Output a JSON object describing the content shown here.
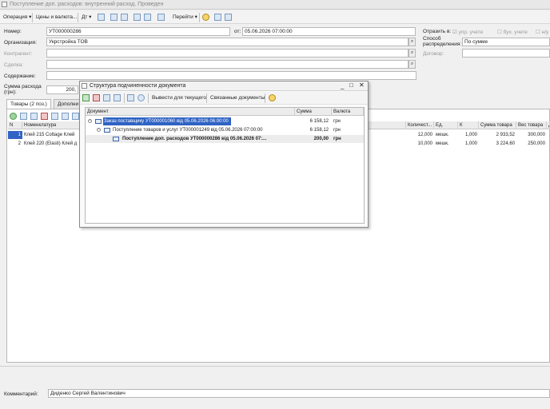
{
  "window": {
    "title": "Поступление доп. расходов: внутренний расход. Проведен"
  },
  "toolbar": {
    "operation": "Операция",
    "prices": "Цены и валюта...",
    "goto": "Перейти"
  },
  "header": {
    "number_label": "Номер:",
    "number_value": "УТ000000286",
    "from_label": "от:",
    "date_value": "05.06.2026 07:00:00",
    "reflect_label": "Отразить в:",
    "mgmt_label": "упр. учете",
    "acct_label": "бух. учете",
    "tax_label": "н/у",
    "org_label": "Организация:",
    "org_value": "Укрстройка ТОВ",
    "method_label": "Способ распределения:",
    "method_value": "По сумме",
    "contractor_label": "Контрагент:",
    "contract_label": "Договор:",
    "deal_label": "Сделка:",
    "content_label": "Содержание:",
    "sum_label": "Сумма расхода (грн):",
    "sum_value": "200,"
  },
  "tabs": [
    {
      "label": "Товары (2 поз.)"
    },
    {
      "label": "Дополни"
    }
  ],
  "goods": {
    "columns": [
      "N",
      "Номенклатура",
      "Количест...",
      "Ед.",
      "К",
      "Сумма товара",
      "Вес товара",
      "Д"
    ],
    "rows": [
      {
        "n": "1",
        "item": "Клей 215 Cottage Клей",
        "qty": "12,000",
        "unit": "мешк.",
        "k": "1,000",
        "sum": "2 933,52",
        "weight": "300,000"
      },
      {
        "n": "2",
        "item": "Клей 220 (Elasti) Клей д",
        "qty": "10,000",
        "unit": "мешк.",
        "k": "1,000",
        "sum": "3 224,60",
        "weight": "250,000"
      }
    ]
  },
  "comment": {
    "label": "Комментарий:",
    "value": "Диденко Сергей Валентинович"
  },
  "dialog": {
    "title": "Структура подчиненности документа",
    "btn_output": "Вывести для текущего",
    "btn_related": "Связанные документы",
    "columns": {
      "doc": "Документ",
      "sum": "Сумма",
      "cur": "Валюта"
    },
    "rows": [
      {
        "doc": "Заказ поставщику УТ000001060 від 05.06.2026 06:00:00",
        "sum": "6 158,12",
        "cur": "грн"
      },
      {
        "doc": "Поступление товаров и услуг УТ000001249 від 05.06.2026 07:00:00",
        "sum": "6 158,12",
        "cur": "грн"
      },
      {
        "doc": "Поступление доп. расходов УТ000000286 від 05.06.2026 07:...",
        "sum": "200,00",
        "cur": "грн"
      }
    ]
  },
  "colors": {
    "selection": "#2f63c4",
    "doc_icon": "#3c64a6"
  }
}
